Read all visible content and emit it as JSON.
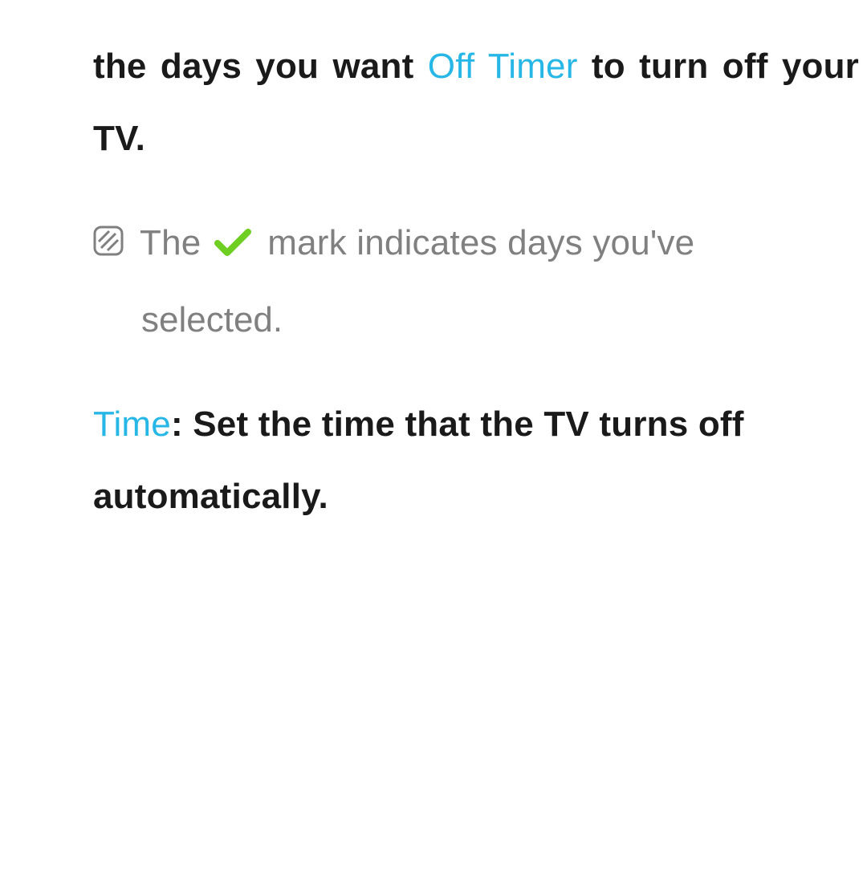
{
  "para1": {
    "pre": "the days you want ",
    "highlight": "Off Timer",
    "post": " to turn off your TV."
  },
  "note": {
    "pre": "The ",
    "post": " mark indicates days you've",
    "line2": "selected."
  },
  "para3": {
    "label": "Time",
    "text": ": Set the time that the TV turns off automatically."
  }
}
